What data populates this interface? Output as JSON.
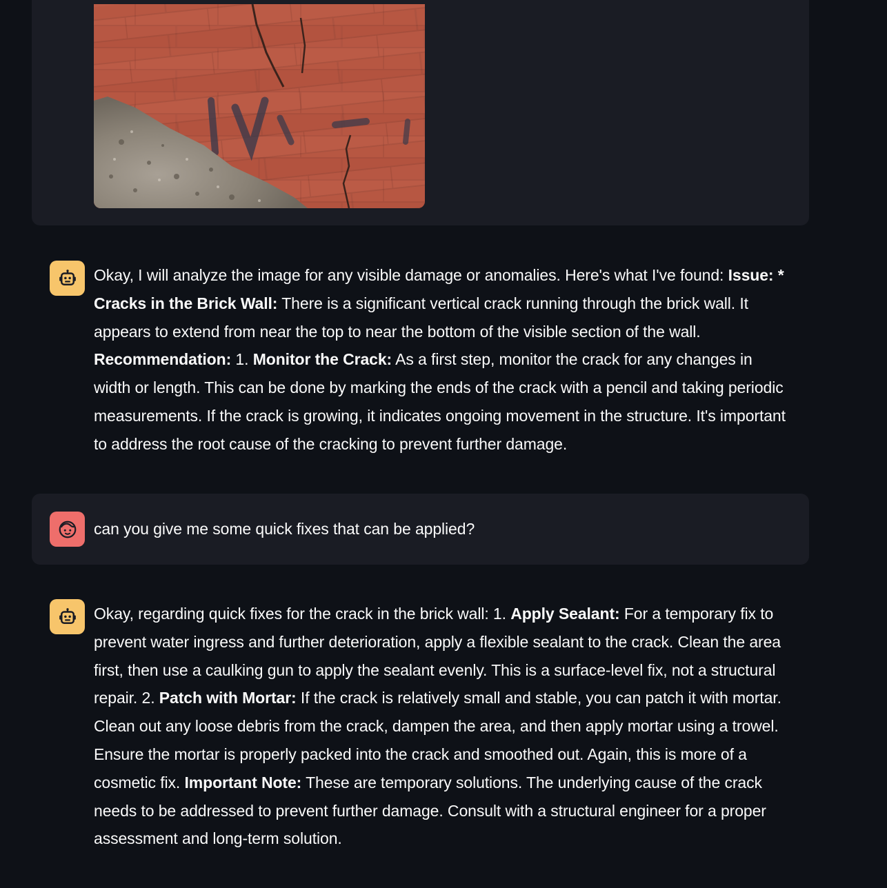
{
  "messages": {
    "image_message": {
      "image_alt": "Brick wall with crack"
    },
    "bot_1": {
      "role": "assistant",
      "avatar_icon": "robot-icon",
      "p1": "Okay, I will analyze the image for any visible damage or anomalies. Here's what I've found: ",
      "b1": "Issue:",
      "p2": " ",
      "b2": "* Cracks in the Brick Wall:",
      "p3": " There is a significant vertical crack running through the brick wall. It appears to extend from near the top to near the bottom of the visible section of the wall. ",
      "b3": "Recommendation:",
      "p4": " 1. ",
      "b4": "Monitor the Crack:",
      "p5": " As a first step, monitor the crack for any changes in width or length. This can be done by marking the ends of the crack with a pencil and taking periodic measurements. If the crack is growing, it indicates ongoing movement in the structure. It's important to address the root cause of the cracking to prevent further damage."
    },
    "user_1": {
      "role": "user",
      "avatar_icon": "face-icon",
      "text": "can you give me some quick fixes that can be applied?"
    },
    "bot_2": {
      "role": "assistant",
      "avatar_icon": "robot-icon",
      "p1": "Okay, regarding quick fixes for the crack in the brick wall: 1. ",
      "b1": "Apply Sealant:",
      "p2": " For a temporary fix to prevent water ingress and further deterioration, apply a flexible sealant to the crack. Clean the area first, then use a caulking gun to apply the sealant evenly. This is a surface-level fix, not a structural repair. 2. ",
      "b2": "Patch with Mortar:",
      "p3": " If the crack is relatively small and stable, you can patch it with mortar. Clean out any loose debris from the crack, dampen the area, and then apply mortar using a trowel. Ensure the mortar is properly packed into the crack and smoothed out. Again, this is more of a cosmetic fix. ",
      "b3": "Important Note:",
      "p4": " These are temporary solutions. The underlying cause of the crack needs to be addressed to prevent further damage. Consult with a structural engineer for a proper assessment and long-term solution."
    }
  },
  "colors": {
    "background": "#0e1117",
    "message_bg": "#1a1c24",
    "bot_avatar": "#f7c56b",
    "user_avatar": "#ee6e6b",
    "text": "#fafafa"
  }
}
